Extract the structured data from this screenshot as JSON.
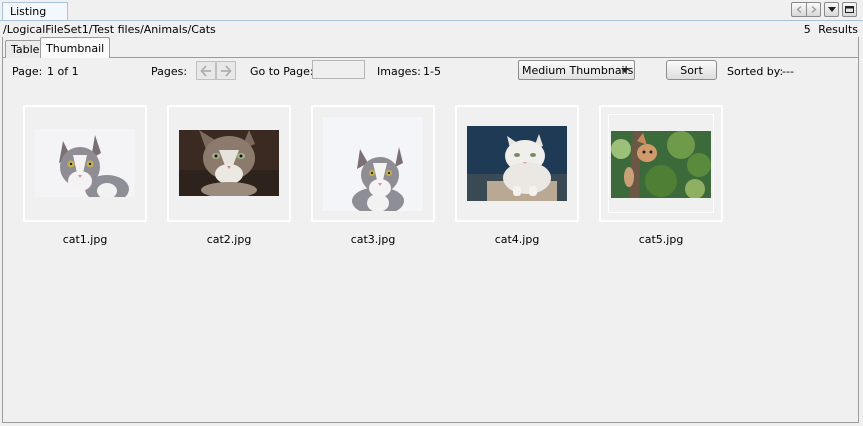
{
  "window": {
    "tab_label": "Listing"
  },
  "path": "/LogicalFileSet1/Test files/Animals/Cats",
  "results": {
    "count": "5",
    "label": "Results"
  },
  "tabs": [
    {
      "label": "Table"
    },
    {
      "label": "Thumbnail"
    }
  ],
  "toolbar": {
    "page_label": "Page:",
    "page_value": "1 of 1",
    "pages_label": "Pages:",
    "goto_label": "Go to Page:",
    "goto_value": "",
    "images_label": "Images:",
    "images_value": "1-5",
    "size_select": "Medium Thumbnails",
    "sort_label": "Sort",
    "sorted_by_label": "Sorted by:",
    "sorted_by_value": "---"
  },
  "thumbnails": [
    {
      "name": "cat1.jpg"
    },
    {
      "name": "cat2.jpg"
    },
    {
      "name": "cat3.jpg"
    },
    {
      "name": "cat4.jpg"
    },
    {
      "name": "cat5.jpg"
    }
  ]
}
